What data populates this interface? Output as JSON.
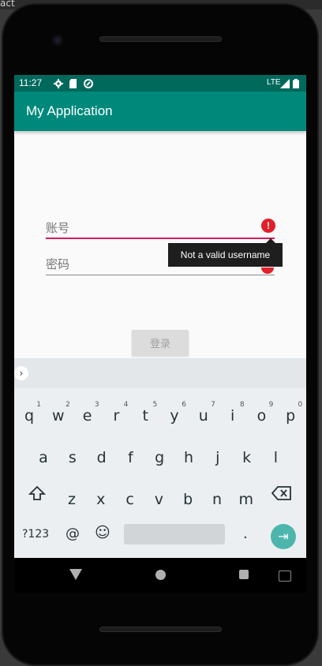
{
  "host": {
    "text": "act"
  },
  "status_bar": {
    "time": "11:27",
    "network": "LTE"
  },
  "app_bar": {
    "title": "My Application"
  },
  "form": {
    "username_placeholder": "账号",
    "password_placeholder": "密码",
    "error_icon": "!",
    "error_tooltip": "Not a valid username",
    "login_label": "登录"
  },
  "keyboard": {
    "row1": [
      {
        "key": "q",
        "hint": "1"
      },
      {
        "key": "w",
        "hint": "2"
      },
      {
        "key": "e",
        "hint": "3"
      },
      {
        "key": "r",
        "hint": "4"
      },
      {
        "key": "t",
        "hint": "5"
      },
      {
        "key": "y",
        "hint": "6"
      },
      {
        "key": "u",
        "hint": "7"
      },
      {
        "key": "i",
        "hint": "8"
      },
      {
        "key": "o",
        "hint": "9"
      },
      {
        "key": "p",
        "hint": "0"
      }
    ],
    "row2": [
      "a",
      "s",
      "d",
      "f",
      "g",
      "h",
      "j",
      "k",
      "l"
    ],
    "row3": [
      "z",
      "x",
      "c",
      "v",
      "b",
      "n",
      "m"
    ],
    "symbols_label": "?123",
    "at_label": "@",
    "period_label": ".",
    "expand_glyph": "›",
    "enter_glyph": "⇥",
    "emoji_glyph": "☺"
  },
  "colors": {
    "status_bar": "#00695c",
    "app_bar": "#00897b",
    "error": "#e0202a",
    "field_error_line": "#d81b60",
    "enter_key": "#4db6ac"
  }
}
